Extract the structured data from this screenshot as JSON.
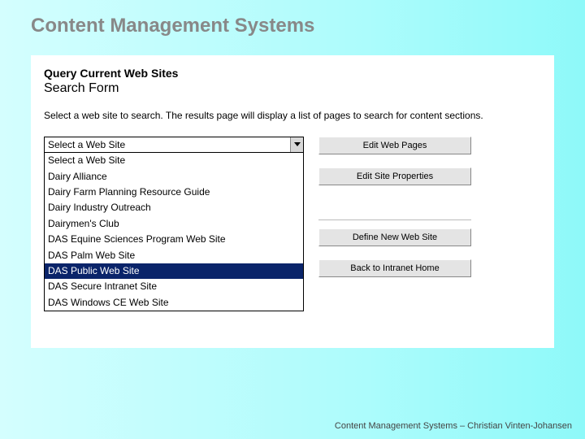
{
  "slide": {
    "title": "Content Management Systems",
    "footer": "Content Management Systems – Christian Vinten-Johansen"
  },
  "panel": {
    "heading": "Query Current Web Sites",
    "subheading": "Search Form",
    "instructions": "Select a web site to search. The results page will display a list of pages to search for content sections."
  },
  "select": {
    "value": "Select a Web Site",
    "options": [
      "Select a Web Site",
      "Dairy Alliance",
      "Dairy Farm Planning Resource Guide",
      "Dairy Industry Outreach",
      "Dairymen's Club",
      "DAS Equine Sciences Program Web Site",
      "DAS Palm Web Site",
      "DAS Public Web Site",
      "DAS Secure Intranet Site",
      "DAS Windows CE Web Site"
    ],
    "selected_index": 7
  },
  "buttons": {
    "edit_pages": "Edit Web Pages",
    "edit_props": "Edit Site Properties",
    "define_new": "Define New Web Site",
    "back_home": "Back to Intranet Home"
  }
}
